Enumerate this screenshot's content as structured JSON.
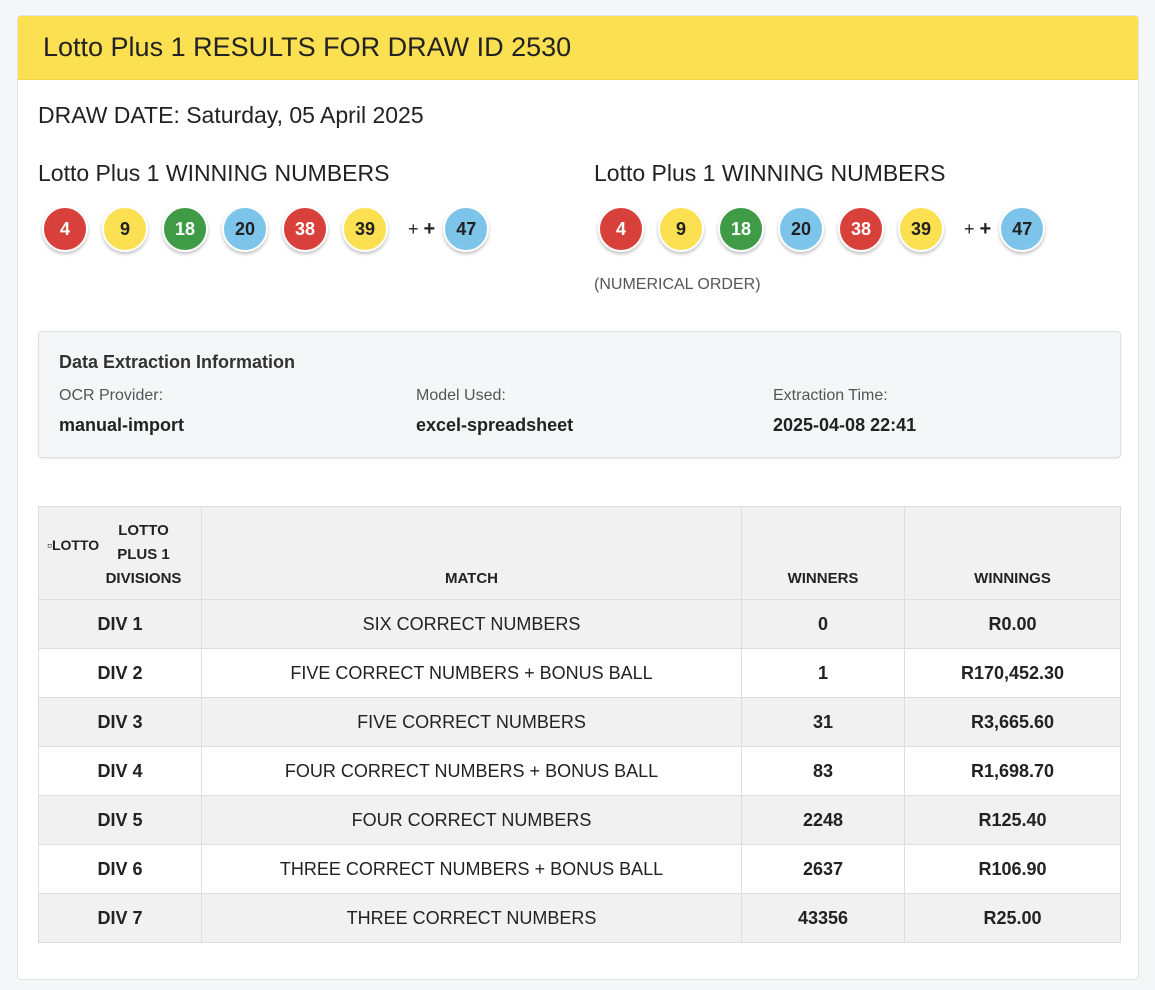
{
  "header": {
    "title": "Lotto Plus 1 RESULTS FOR DRAW ID 2530"
  },
  "draw_date": "DRAW DATE: Saturday, 05 April 2025",
  "winning_numbers_left": {
    "heading": "Lotto Plus 1 WINNING NUMBERS",
    "balls": [
      {
        "value": "4",
        "color": "red"
      },
      {
        "value": "9",
        "color": "yellow"
      },
      {
        "value": "18",
        "color": "green"
      },
      {
        "value": "20",
        "color": "blue"
      },
      {
        "value": "38",
        "color": "red"
      },
      {
        "value": "39",
        "color": "yellow"
      }
    ],
    "plus": "+",
    "plus_bold": "+",
    "bonus": {
      "value": "47",
      "color": "blue"
    }
  },
  "winning_numbers_right": {
    "heading": "Lotto Plus 1 WINNING NUMBERS",
    "balls": [
      {
        "value": "4",
        "color": "red"
      },
      {
        "value": "9",
        "color": "yellow"
      },
      {
        "value": "18",
        "color": "green"
      },
      {
        "value": "20",
        "color": "blue"
      },
      {
        "value": "38",
        "color": "red"
      },
      {
        "value": "39",
        "color": "yellow"
      }
    ],
    "plus": "+",
    "plus_bold": "+",
    "bonus": {
      "value": "47",
      "color": "blue"
    },
    "note": "(NUMERICAL ORDER)"
  },
  "extraction": {
    "title": "Data Extraction Information",
    "ocr_label": "OCR Provider:",
    "ocr_value": "manual-import",
    "model_label": "Model Used:",
    "model_value": "excel-spreadsheet",
    "time_label": "Extraction Time:",
    "time_value": "2025-04-08 22:41"
  },
  "table": {
    "logo_alt": "LOTTO",
    "logo_title_1": "LOTTO",
    "logo_title_2": "PLUS 1",
    "logo_title_3": "DIVISIONS",
    "headers": {
      "match": "MATCH",
      "winners": "WINNERS",
      "winnings": "WINNINGS"
    },
    "rows": [
      {
        "div": "DIV 1",
        "match": "SIX CORRECT NUMBERS",
        "winners": "0",
        "winnings": "R0.00"
      },
      {
        "div": "DIV 2",
        "match": "FIVE CORRECT NUMBERS + BONUS BALL",
        "winners": "1",
        "winnings": "R170,452.30"
      },
      {
        "div": "DIV 3",
        "match": "FIVE CORRECT NUMBERS",
        "winners": "31",
        "winnings": "R3,665.60"
      },
      {
        "div": "DIV 4",
        "match": "FOUR CORRECT NUMBERS + BONUS BALL",
        "winners": "83",
        "winnings": "R1,698.70"
      },
      {
        "div": "DIV 5",
        "match": "FOUR CORRECT NUMBERS",
        "winners": "2248",
        "winnings": "R125.40"
      },
      {
        "div": "DIV 6",
        "match": "THREE CORRECT NUMBERS + BONUS BALL",
        "winners": "2637",
        "winnings": "R106.90"
      },
      {
        "div": "DIV 7",
        "match": "THREE CORRECT NUMBERS",
        "winners": "43356",
        "winnings": "R25.00"
      }
    ]
  }
}
